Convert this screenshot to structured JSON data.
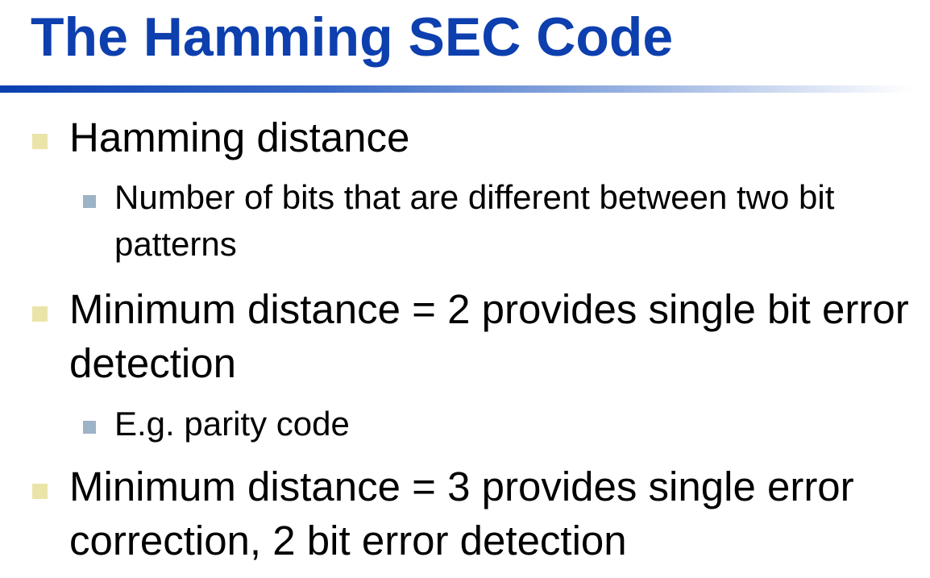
{
  "slide": {
    "title": "The Hamming SEC Code",
    "bullets": [
      {
        "level": 1,
        "text": "Hamming distance"
      },
      {
        "level": 2,
        "text": "Number of bits that are different between two bit patterns"
      },
      {
        "level": 1,
        "text": "Minimum distance = 2 provides single bit error detection"
      },
      {
        "level": 2,
        "text": "E.g. parity code"
      },
      {
        "level": 1,
        "text": "Minimum distance = 3 provides single error correction, 2 bit error detection"
      }
    ]
  },
  "colors": {
    "title": "#0d3fae",
    "bullet_level1": "#ebe4a8",
    "bullet_level2": "#9db3c6"
  }
}
